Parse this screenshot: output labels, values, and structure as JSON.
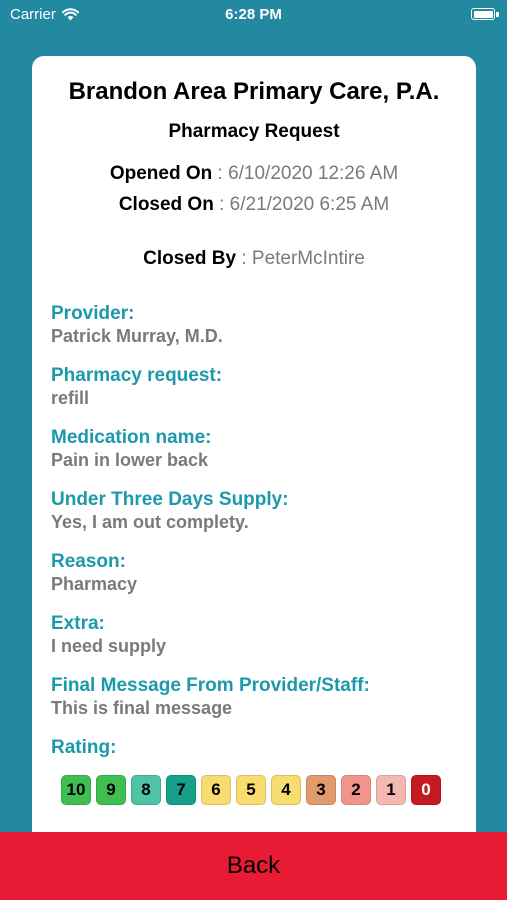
{
  "status_bar": {
    "carrier": "Carrier",
    "time": "6:28 PM",
    "wifi_icon": "wifi-icon",
    "battery_icon": "battery-icon"
  },
  "header": {
    "practice_name": "Brandon Area Primary Care, P.A.",
    "request_type": "Pharmacy Request"
  },
  "meta": {
    "opened_label": "Opened On",
    "opened_value": "6/10/2020  12:26 AM",
    "closed_label": "Closed On",
    "closed_value": "6/21/2020  6:25 AM",
    "closed_by_label": "Closed By",
    "closed_by_value": "PeterMcIntire",
    "separator": " : "
  },
  "fields": [
    {
      "label": "Provider:",
      "value": "Patrick Murray, M.D."
    },
    {
      "label": "Pharmacy request:",
      "value": "refill"
    },
    {
      "label": "Medication name:",
      "value": "Pain in lower back"
    },
    {
      "label": "Under Three Days Supply:",
      "value": "Yes, I am out complety."
    },
    {
      "label": "Reason:",
      "value": "Pharmacy"
    },
    {
      "label": "Extra:",
      "value": "I need supply"
    },
    {
      "label": "Final Message From Provider/Staff:",
      "value": "This is final message"
    }
  ],
  "rating": {
    "label": "Rating:",
    "scale": [
      "10",
      "9",
      "8",
      "7",
      "6",
      "5",
      "4",
      "3",
      "2",
      "1",
      "0"
    ],
    "colors": [
      "#3fbf52",
      "#3fbf52",
      "#50c3a6",
      "#16a08a",
      "#f7dc6f",
      "#f7dc6f",
      "#f7dc6f",
      "#e09a6b",
      "#f1958b",
      "#f4b8b2",
      "#c41a22"
    ]
  },
  "footer": {
    "back_label": "Back"
  }
}
